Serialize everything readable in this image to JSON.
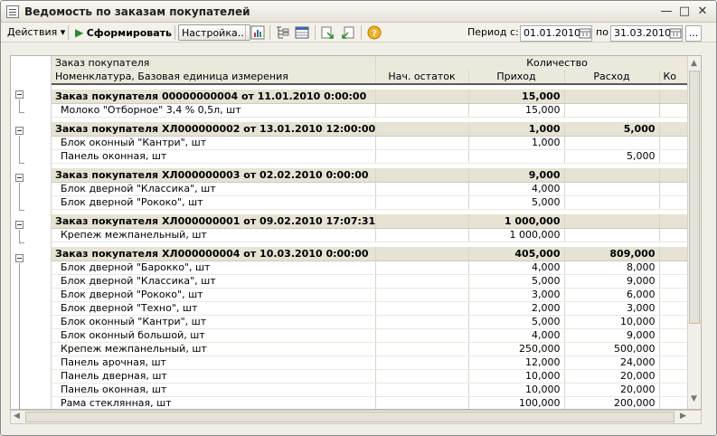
{
  "window": {
    "title": "Ведомость по заказам покупателей"
  },
  "toolbar": {
    "actions_label": "Действия",
    "generate_label": "Сформировать",
    "settings_label": "Настройка...",
    "period_from_label": "Период с:",
    "period_from_value": "01.01.2010",
    "period_to_label": "по",
    "period_to_value": "31.03.2010",
    "more_label": "..."
  },
  "table": {
    "header_top": {
      "col1": "Заказ покупателя",
      "col2": "Количество"
    },
    "header_bottom": {
      "col1": "Номенклатура, Базовая единица измерения",
      "col2": "Нач. остаток",
      "col3": "Приход",
      "col4": "Расход",
      "col5": "Ко"
    },
    "groups": [
      {
        "title": "Заказ покупателя 00000000004 от 11.01.2010 0:00:00",
        "start": "",
        "income": "15,000",
        "expense": "",
        "items": [
          {
            "name": "Молоко \"Отборное\" 3,4 % 0,5л, шт",
            "start": "",
            "income": "15,000",
            "expense": ""
          }
        ]
      },
      {
        "title": "Заказ покупателя ХЛ000000002 от 13.01.2010 12:00:00",
        "start": "",
        "income": "1,000",
        "expense": "5,000",
        "items": [
          {
            "name": "Блок оконный \"Кантри\", шт",
            "start": "",
            "income": "1,000",
            "expense": ""
          },
          {
            "name": "Панель оконная, шт",
            "start": "",
            "income": "",
            "expense": "5,000"
          }
        ]
      },
      {
        "title": "Заказ покупателя ХЛ000000003 от 02.02.2010 0:00:00",
        "start": "",
        "income": "9,000",
        "expense": "",
        "items": [
          {
            "name": "Блок дверной \"Классика\", шт",
            "start": "",
            "income": "4,000",
            "expense": ""
          },
          {
            "name": "Блок дверной \"Рококо\", шт",
            "start": "",
            "income": "5,000",
            "expense": ""
          }
        ]
      },
      {
        "title": "Заказ покупателя ХЛ000000001 от 09.02.2010 17:07:31",
        "start": "",
        "income": "1 000,000",
        "expense": "",
        "items": [
          {
            "name": "Крепеж межпанельный, шт",
            "start": "",
            "income": "1 000,000",
            "expense": ""
          }
        ]
      },
      {
        "title": "Заказ покупателя ХЛ000000004 от 10.03.2010 0:00:00",
        "start": "",
        "income": "405,000",
        "expense": "809,000",
        "items": [
          {
            "name": "Блок дверной \"Барокко\", шт",
            "start": "",
            "income": "4,000",
            "expense": "8,000"
          },
          {
            "name": "Блок дверной \"Классика\", шт",
            "start": "",
            "income": "5,000",
            "expense": "9,000"
          },
          {
            "name": "Блок дверной \"Рококо\", шт",
            "start": "",
            "income": "3,000",
            "expense": "6,000"
          },
          {
            "name": "Блок дверной \"Техно\", шт",
            "start": "",
            "income": "2,000",
            "expense": "3,000"
          },
          {
            "name": "Блок оконный \"Кантри\", шт",
            "start": "",
            "income": "5,000",
            "expense": "10,000"
          },
          {
            "name": "Блок оконный большой, шт",
            "start": "",
            "income": "4,000",
            "expense": "9,000"
          },
          {
            "name": "Крепеж межпанельный, шт",
            "start": "",
            "income": "250,000",
            "expense": "500,000"
          },
          {
            "name": "Панель арочная, шт",
            "start": "",
            "income": "12,000",
            "expense": "24,000"
          },
          {
            "name": "Панель дверная, шт",
            "start": "",
            "income": "10,000",
            "expense": "20,000"
          },
          {
            "name": "Панель оконная, шт",
            "start": "",
            "income": "10,000",
            "expense": "20,000"
          },
          {
            "name": "Рама стеклянная, шт",
            "start": "",
            "income": "100,000",
            "expense": "200,000"
          }
        ]
      }
    ]
  }
}
